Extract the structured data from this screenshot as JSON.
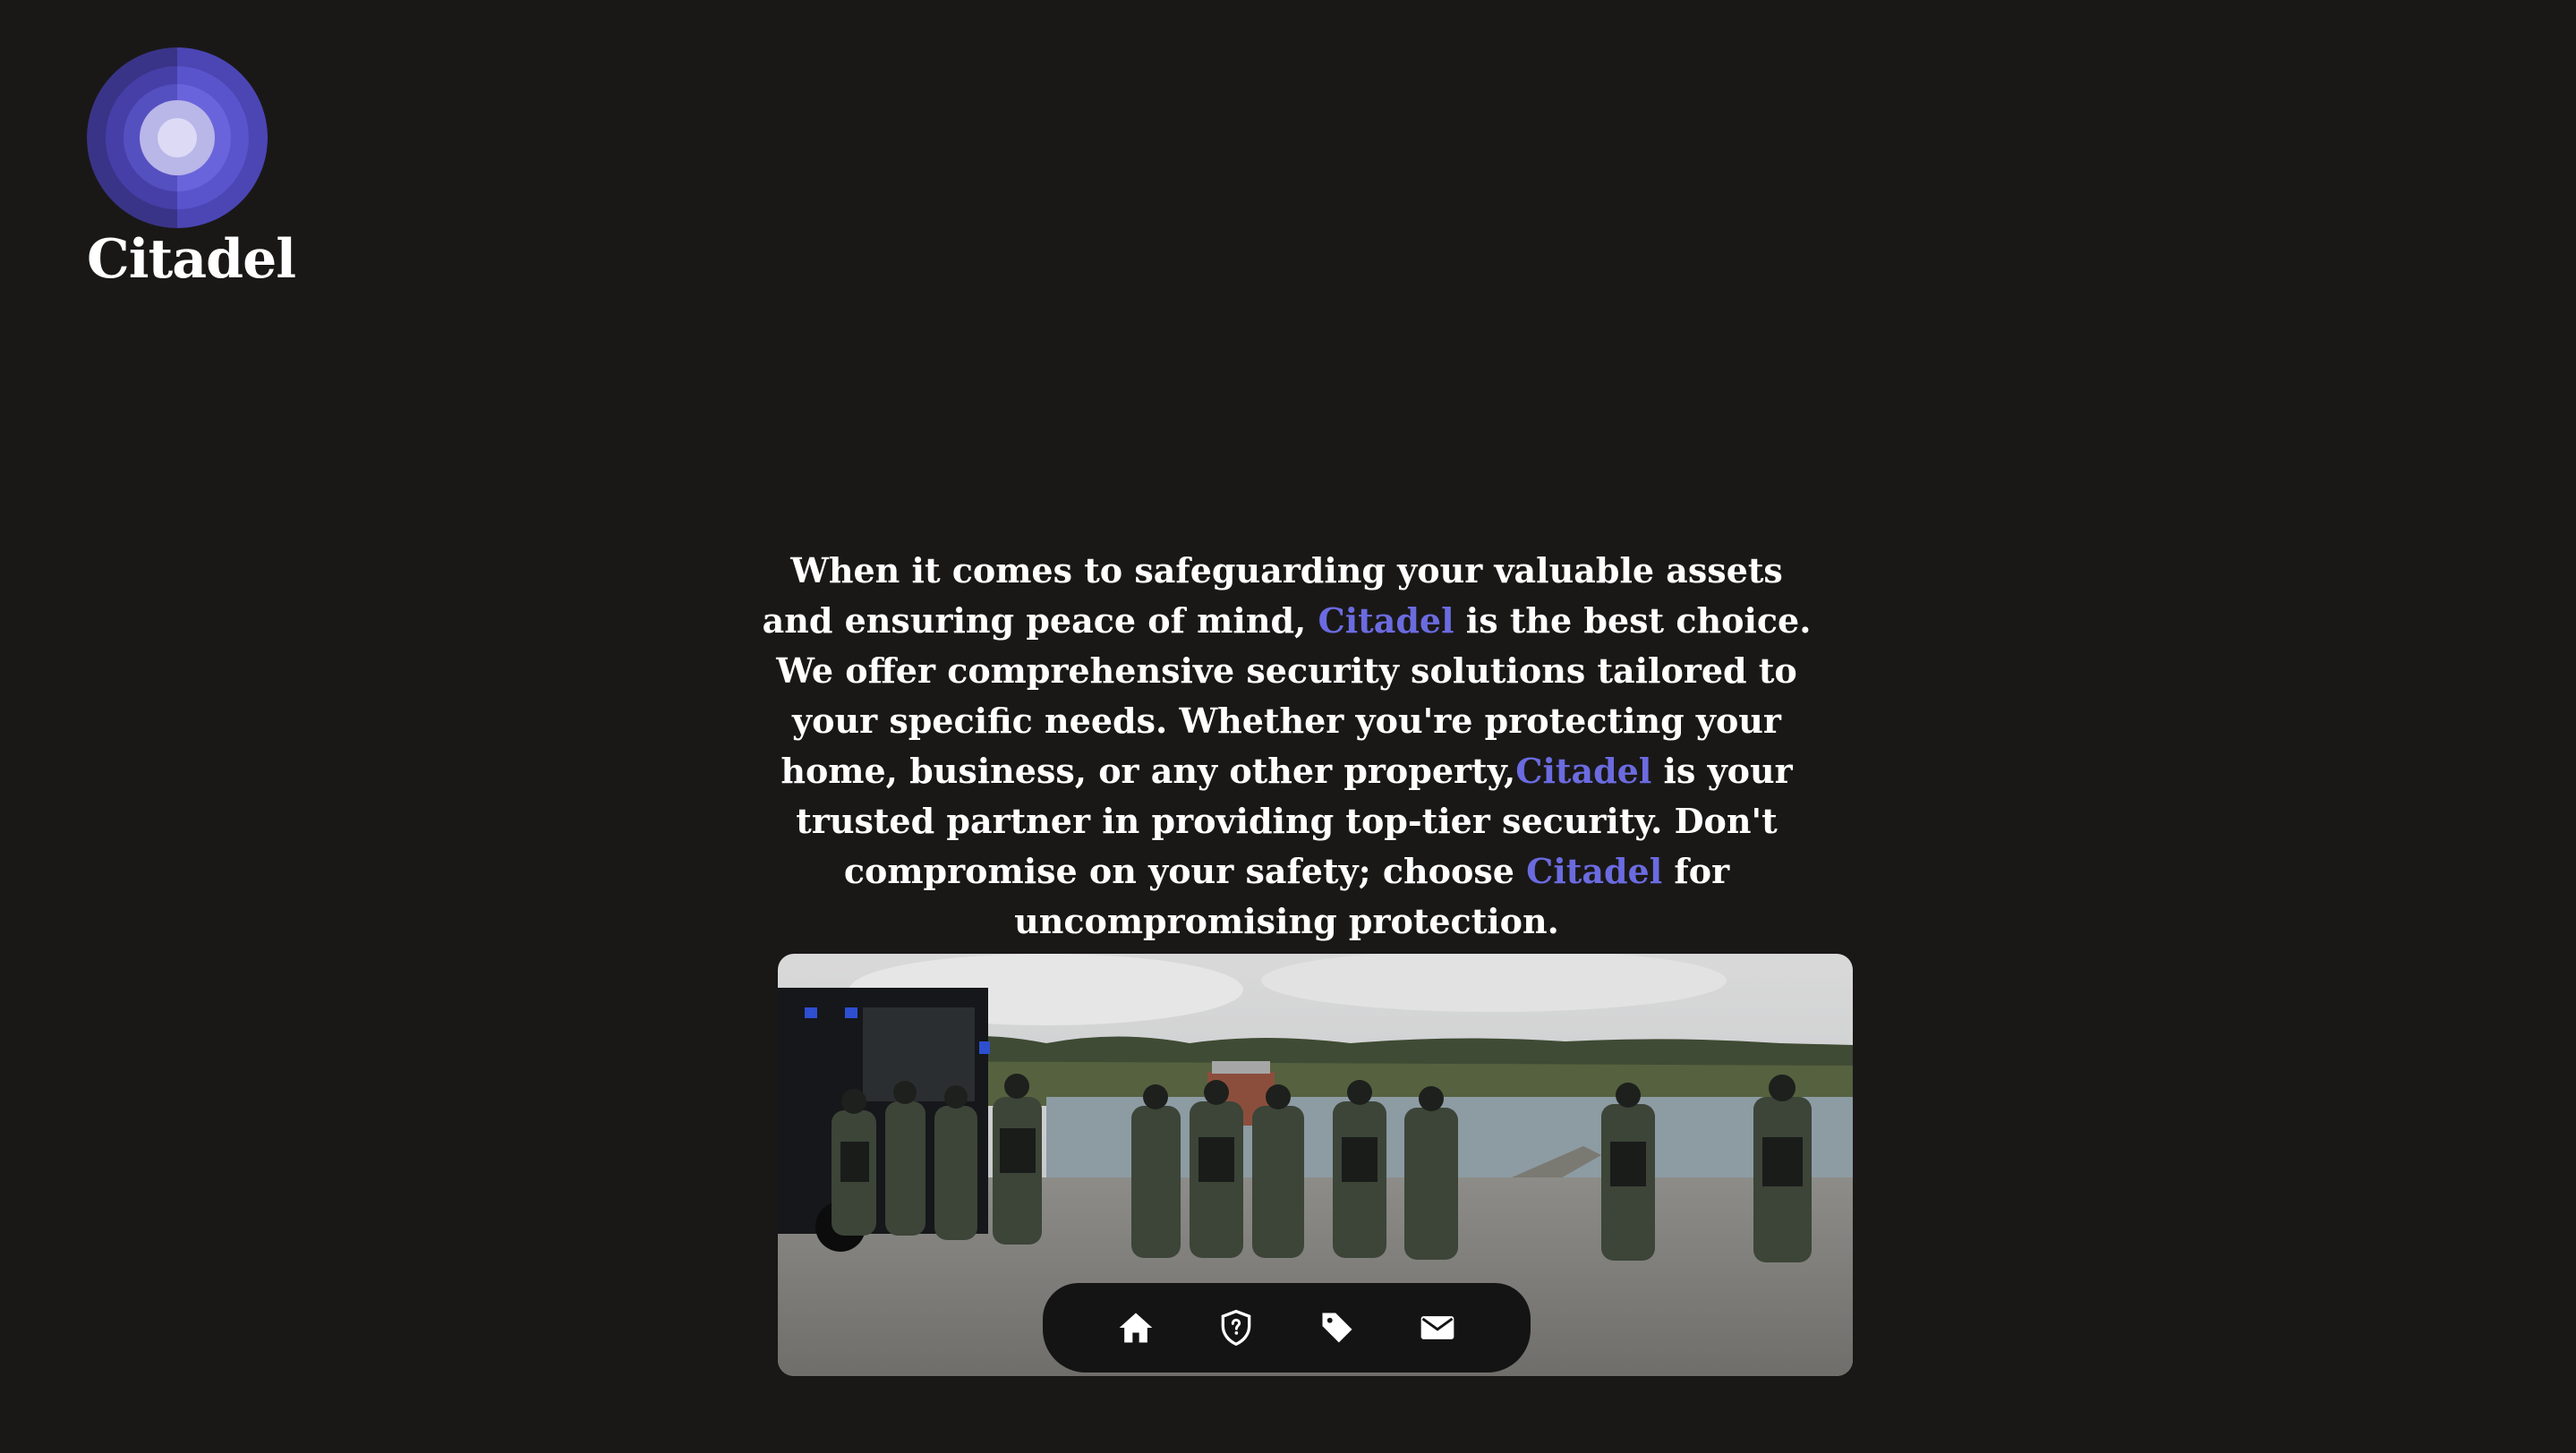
{
  "brand": {
    "name": "Citadel",
    "logo_colors": [
      "#3a3488",
      "#4b46b4",
      "#5c57d0",
      "#b9b6e8",
      "#dcdaf5"
    ]
  },
  "intro": {
    "part1": "When it comes to safeguarding your valuable assets and ensuring peace of mind, ",
    "brand1": "Citadel",
    "part2": " is the best choice. We offer comprehensive security solutions tailored to your specific needs. Whether you're protecting your home, business, or any other property,",
    "brand2": "Citadel",
    "part3": " is your trusted partner in providing top-tier security. Don't compromise on your safety; choose ",
    "brand3": "Citadel",
    "part4": " for uncompromising protection."
  },
  "hero_image": {
    "subject": "security-team-photo"
  },
  "nav": {
    "items": [
      {
        "icon": "home-icon"
      },
      {
        "icon": "shield-question-icon"
      },
      {
        "icon": "tag-icon"
      },
      {
        "icon": "mail-icon"
      }
    ]
  },
  "colors": {
    "background": "#1a1817",
    "accent": "#6b6be0",
    "nav_background": "#141414"
  }
}
